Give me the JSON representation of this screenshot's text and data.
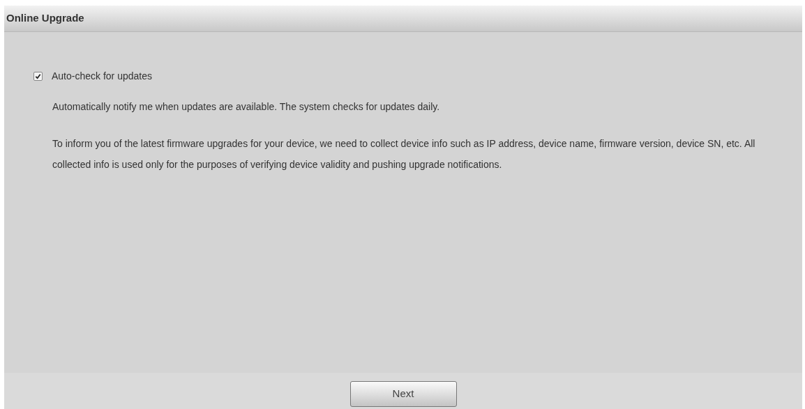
{
  "panel": {
    "title": "Online Upgrade"
  },
  "auto_check": {
    "label": "Auto-check for updates",
    "checked": true
  },
  "paragraphs": [
    "Automatically notify me when updates are available. The system checks for updates daily.",
    "To inform you of the latest firmware upgrades for your device, we need to collect device info such as IP address, device name, firmware version, device SN, etc. All collected info is used only for the purposes of verifying device validity and pushing upgrade notifications."
  ],
  "buttons": [
    "Next"
  ]
}
